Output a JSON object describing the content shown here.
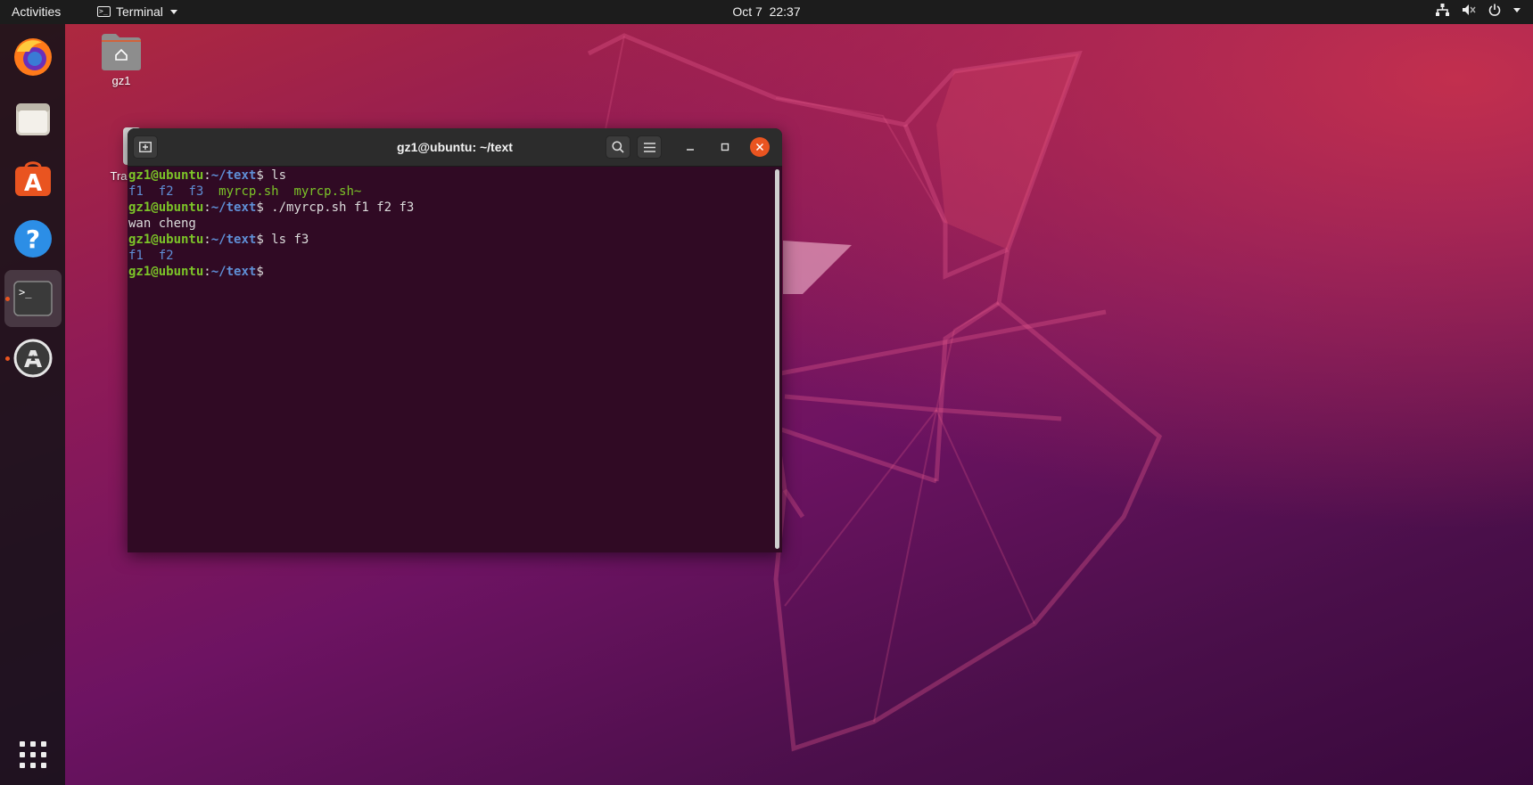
{
  "topbar": {
    "activities": "Activities",
    "app_name": "Terminal",
    "clock_date": "Oct 7",
    "clock_time": "22:37"
  },
  "dock": {
    "items": [
      {
        "name": "Firefox",
        "icon": "firefox-icon"
      },
      {
        "name": "Files",
        "icon": "files-icon"
      },
      {
        "name": "Ubuntu Software",
        "icon": "software-store-icon"
      },
      {
        "name": "Help",
        "icon": "help-icon"
      },
      {
        "name": "Terminal",
        "icon": "terminal-icon",
        "active": true,
        "running": true
      },
      {
        "name": "Software Updater",
        "icon": "updater-icon",
        "running": true
      }
    ],
    "show_apps_icon": "show-applications-icon"
  },
  "desktop": {
    "home_label": "gz1",
    "trash_label": "Tra"
  },
  "terminal": {
    "title": "gz1@ubuntu: ~/text",
    "lines": [
      {
        "user": "gz1@ubuntu",
        "path": "~/text",
        "cmd": " ls"
      },
      {
        "files": [
          "f1",
          "f2",
          "f3"
        ],
        "scripts": [
          "myrcp.sh",
          "myrcp.sh~"
        ]
      },
      {
        "user": "gz1@ubuntu",
        "path": "~/text",
        "cmd": " ./myrcp.sh f1 f2 f3"
      },
      {
        "text": "wan cheng"
      },
      {
        "user": "gz1@ubuntu",
        "path": "~/text",
        "cmd": " ls f3"
      },
      {
        "files": [
          "f1",
          "f2"
        ]
      },
      {
        "user": "gz1@ubuntu",
        "path": "~/text",
        "cmd": ""
      }
    ]
  },
  "colors": {
    "accent": "#e95420",
    "terminal_bg": "#300a24",
    "prompt_user": "#7cc428",
    "prompt_path": "#5f8fd6"
  }
}
